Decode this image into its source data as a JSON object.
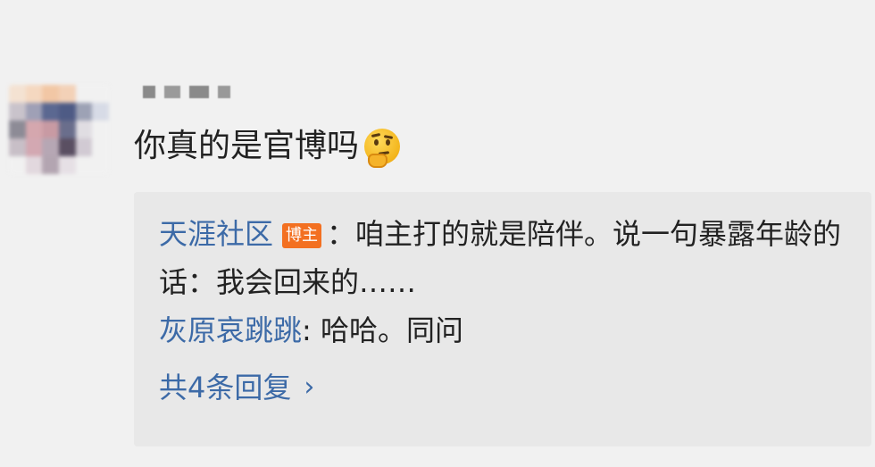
{
  "comment": {
    "text": "你真的是官博吗",
    "emoji": "thinking-face-icon"
  },
  "replies": [
    {
      "user": "天涯社区",
      "badge": "博主",
      "text": "：咱主打的就是陪伴。说一句暴露年龄的话：我会回来的……"
    },
    {
      "user": "灰原哀跳跳",
      "text": ": 哈哈。同问"
    }
  ],
  "reply_count_label": "共4条回复",
  "colors": {
    "background": "#f1f1f1",
    "reply_box": "#e8e8e8",
    "link_blue": "#3c6aa7",
    "badge_orange": "#f37021",
    "text": "#222222"
  }
}
